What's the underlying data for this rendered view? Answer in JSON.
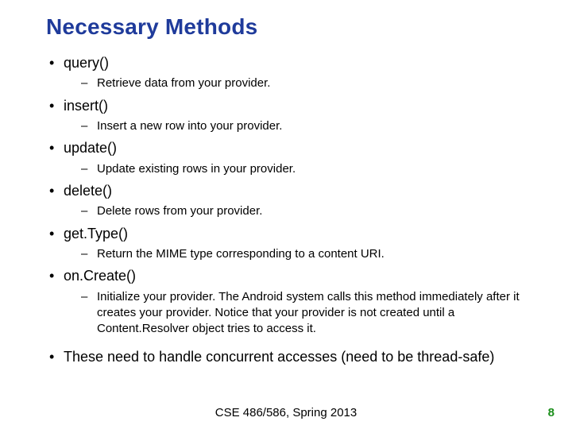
{
  "title": "Necessary Methods",
  "methods": [
    {
      "name": "query()",
      "desc": "Retrieve data from your provider."
    },
    {
      "name": "insert()",
      "desc": "Insert a new row into your provider."
    },
    {
      "name": "update()",
      "desc": "Update existing rows in your provider."
    },
    {
      "name": "delete()",
      "desc": "Delete rows from your provider."
    },
    {
      "name": "get.Type()",
      "desc": "Return the MIME type corresponding to a content URI."
    },
    {
      "name": "on.Create()",
      "desc": "Initialize your provider. The Android system calls this method immediately after it creates your provider. Notice that your provider is not created until a Content.Resolver object tries to access it."
    }
  ],
  "summary": "These need to handle concurrent accesses (need to be thread-safe)",
  "footer": "CSE 486/586, Spring 2013",
  "page": "8"
}
